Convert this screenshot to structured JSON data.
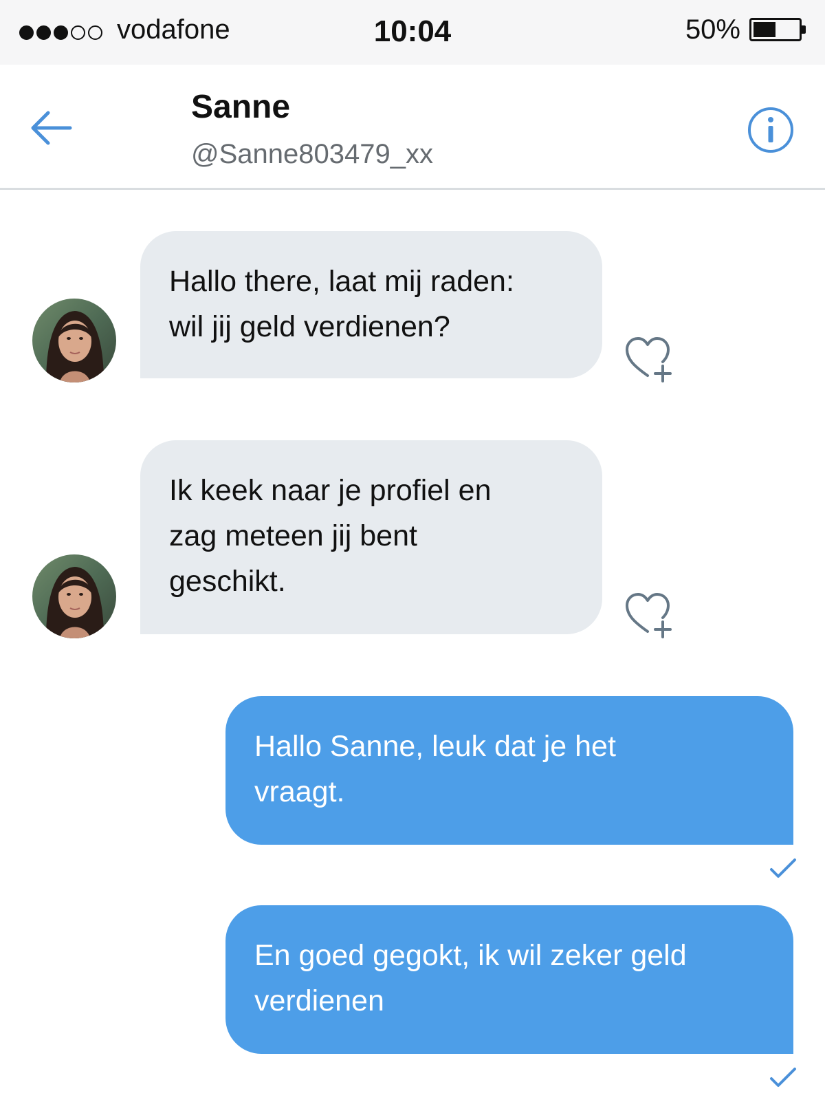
{
  "status_bar": {
    "carrier": "vodafone",
    "signal_bars_filled": 3,
    "signal_bars_total": 5,
    "time": "10:04",
    "battery_percent": "50%",
    "battery_level": 0.5
  },
  "header": {
    "name": "Sanne",
    "handle": "@Sanne803479_xx",
    "back_icon": "arrow-left-icon",
    "info_icon": "info-circle-icon",
    "accent_color": "#4a90d9"
  },
  "messages": [
    {
      "direction": "incoming",
      "lines": [
        "Hallo there, laat mij raden:",
        "wil jij geld verdienen?"
      ],
      "like_icon": "heart-plus-icon"
    },
    {
      "direction": "incoming",
      "lines": [
        "Ik keek naar je profiel en",
        "zag meteen jij bent",
        "geschikt."
      ],
      "like_icon": "heart-plus-icon"
    },
    {
      "direction": "outgoing",
      "lines": [
        "Hallo Sanne, leuk dat je het",
        "vraagt."
      ],
      "status_icon": "checkmark-icon"
    },
    {
      "direction": "outgoing",
      "lines": [
        "En goed gegokt, ik wil zeker geld",
        "verdienen"
      ],
      "status_icon": "checkmark-icon"
    }
  ],
  "colors": {
    "incoming_bubble": "#e7ebef",
    "outgoing_bubble": "#4d9ee8",
    "status_bar_bg": "#f6f6f7",
    "handle_text": "#666b70"
  }
}
